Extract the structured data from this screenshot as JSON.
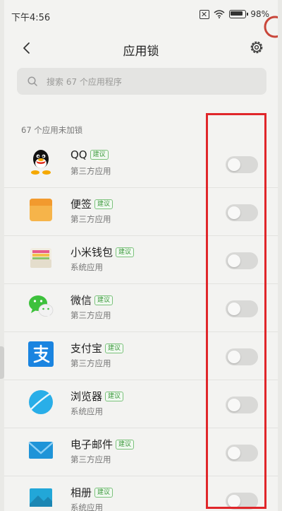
{
  "status_bar": {
    "time": "下午4:56",
    "battery": "98%"
  },
  "header": {
    "title": "应用锁"
  },
  "search": {
    "placeholder": "搜索 67 个应用程序"
  },
  "section": {
    "title": "67 个应用未加锁"
  },
  "apps": [
    {
      "name": "QQ",
      "badge": "建议",
      "type": "第三方应用",
      "icon": "qq-icon",
      "locked": false
    },
    {
      "name": "便签",
      "badge": "建议",
      "type": "第三方应用",
      "icon": "notes-icon",
      "locked": false
    },
    {
      "name": "小米钱包",
      "badge": "建议",
      "type": "系统应用",
      "icon": "wallet-icon",
      "locked": false
    },
    {
      "name": "微信",
      "badge": "建议",
      "type": "第三方应用",
      "icon": "wechat-icon",
      "locked": false
    },
    {
      "name": "支付宝",
      "badge": "建议",
      "type": "第三方应用",
      "icon": "alipay-icon",
      "locked": false
    },
    {
      "name": "浏览器",
      "badge": "建议",
      "type": "系统应用",
      "icon": "browser-icon",
      "locked": false
    },
    {
      "name": "电子邮件",
      "badge": "建议",
      "type": "第三方应用",
      "icon": "email-icon",
      "locked": false
    },
    {
      "name": "相册",
      "badge": "建议",
      "type": "系统应用",
      "icon": "gallery-icon",
      "locked": false
    }
  ],
  "colors": {
    "highlight": "#e0262a",
    "badge_green": "#3f9b3f"
  }
}
